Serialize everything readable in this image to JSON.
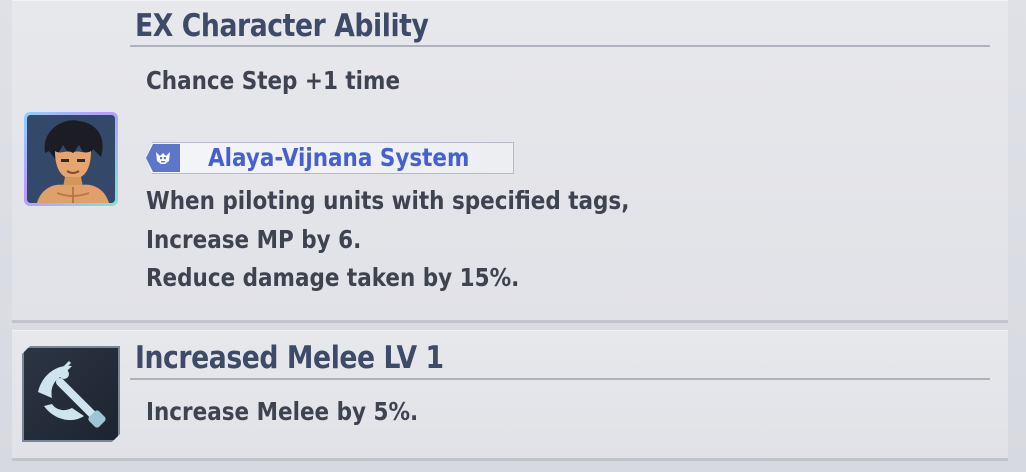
{
  "ex_ability": {
    "title": "EX Character Ability",
    "description": "Chance Step +1 time",
    "tag": {
      "icon": "mobile-suit-head-icon",
      "label": "Alaya-Vijnana System"
    },
    "effects": [
      "When piloting units with specified tags,",
      "Increase MP by 6.",
      "Reduce damage taken by 15%."
    ]
  },
  "skill": {
    "title": "Increased Melee LV 1",
    "icon": "melee-weapon-icon",
    "description": "Increase Melee by 5%."
  },
  "colors": {
    "title": "#3d4a68",
    "body": "#3e434f",
    "tag_text": "#4560cf",
    "tag_icon_bg": "#5d76c9"
  }
}
